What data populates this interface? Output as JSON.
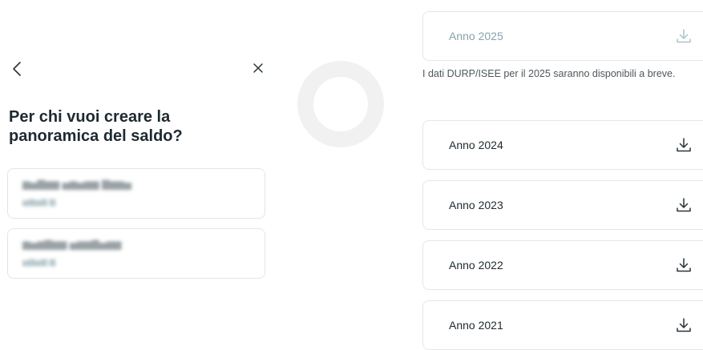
{
  "left_panel": {
    "title": "Per chi vuoi creare la panoramica del saldo?",
    "accounts": [
      {
        "name": "Account holder name (blurred)",
        "detail": "Account number (blurred)"
      },
      {
        "name": "Account holder name (blurred)",
        "detail": "Account number (blurred)"
      }
    ]
  },
  "right_panel": {
    "years": [
      {
        "label": "Anno 2025",
        "enabled": false
      },
      {
        "label": "Anno 2024",
        "enabled": true
      },
      {
        "label": "Anno 2023",
        "enabled": true
      },
      {
        "label": "Anno 2022",
        "enabled": true
      },
      {
        "label": "Anno 2021",
        "enabled": true
      }
    ],
    "note": "I dati DURP/ISEE per il 2025 saranno disponibili a breve."
  },
  "colors": {
    "text": "#1d2a30",
    "muted": "#86a3ab",
    "border": "#e1e7e9"
  }
}
